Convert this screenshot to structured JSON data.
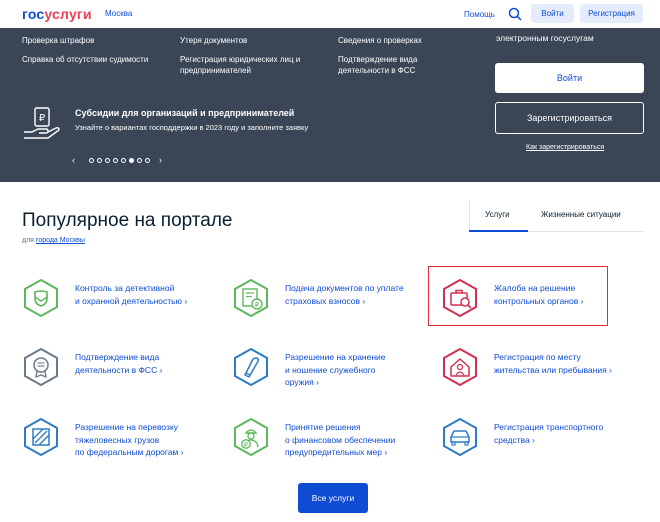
{
  "header": {
    "logo_part1": "гос",
    "logo_part2": "услуги",
    "city": "Москва",
    "help": "Помощь",
    "login": "Войти",
    "register": "Регистрация"
  },
  "dark": {
    "links": [
      "Проверка штрафов",
      "Утеря документов",
      "Сведения о проверках",
      "Справка об отсутствии судимости",
      "Регистрация юридических лиц и",
      "предпринимателей",
      "Подтверждение вида",
      "деятельности в ФСС"
    ],
    "right_title": "электронным госуслугам",
    "login_button": "Войти",
    "register_button": "Зарегистрироваться",
    "how_register": "Как зарегистрироваться",
    "promo_title": "Субсидии для организаций и предпринимателей",
    "promo_subtitle": "Узнайте о вариантах господдержки в 2023 году и заполните заявку",
    "carousel_prev": "‹",
    "carousel_next": "›"
  },
  "popular": {
    "title": "Популярное на портале",
    "subtitle_prefix": "для",
    "subtitle_link": "города Москвы",
    "tabs": [
      "Услуги",
      "Жизненные ситуации"
    ],
    "services": [
      {
        "lines": [
          "Контроль за детективной",
          "и охранной деятельностью ›"
        ],
        "icon": "shield-icon",
        "color": "#5cb85c"
      },
      {
        "lines": [
          "Подача документов по уплате",
          "страховых взносов ›"
        ],
        "icon": "document-ruble-icon",
        "color": "#5cb85c"
      },
      {
        "lines": [
          "Жалоба на решение",
          "контрольных органов ›"
        ],
        "icon": "briefcase-search-icon",
        "color": "#d1304f"
      },
      {
        "lines": [
          "Подтверждение вида",
          "деятельности в ФСС ›"
        ],
        "icon": "certificate-icon",
        "color": "#6c7a89"
      },
      {
        "lines": [
          "Разрешение на хранение",
          "и ношение служебного",
          "оружия ›"
        ],
        "icon": "bullet-icon",
        "color": "#2f7cc6"
      },
      {
        "lines": [
          "Регистрация по месту",
          "жительства или пребывания ›"
        ],
        "icon": "home-person-icon",
        "color": "#d1304f"
      },
      {
        "lines": [
          "Разрешение на перевозку",
          "тяжеловесных грузов",
          "по федеральным дорогам ›"
        ],
        "icon": "road-icon",
        "color": "#2f7cc6"
      },
      {
        "lines": [
          "Принятие решения",
          "о финансовом обеспечении",
          "предупредительных мер ›"
        ],
        "icon": "worker-ruble-icon",
        "color": "#5cb85c"
      },
      {
        "lines": [
          "Регистрация транспортного",
          "средства ›"
        ],
        "icon": "car-icon",
        "color": "#2f7cc6"
      }
    ],
    "all_services": "Все услуги"
  }
}
